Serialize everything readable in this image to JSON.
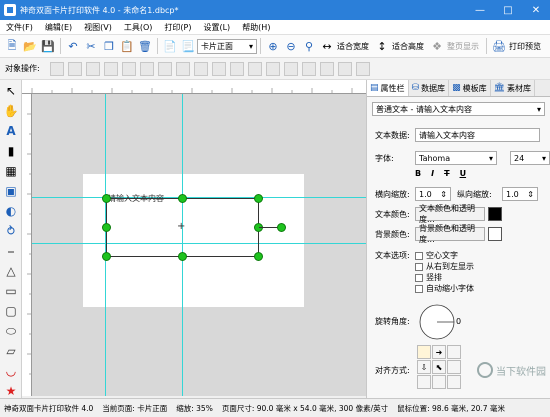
{
  "window": {
    "title": "神奇双面卡片打印软件 4.0 - 未命名1.dbcp*"
  },
  "menu": [
    "文件(F)",
    "编辑(E)",
    "视图(V)",
    "工具(O)",
    "打印(P)",
    "设置(L)",
    "帮助(H)"
  ],
  "toolbar": {
    "side_select": "卡片正面",
    "fit_width": "适合宽度",
    "fit_height": "适合高度",
    "full_display": "整页显示",
    "print_preview": "打印预览"
  },
  "toolbar2": {
    "label": "对象操作:"
  },
  "canvas": {
    "sample_text": "请输入文本内容"
  },
  "panel": {
    "tabs": [
      "属性栏",
      "数据库",
      "模板库",
      "素材库"
    ],
    "object_type": "普通文本 - 请输入文本内容",
    "text_data_label": "文本数据:",
    "text_data_value": "请输入文本内容",
    "font_label": "字体:",
    "font_value": "Tahoma",
    "font_size": "24",
    "bold": "B",
    "italic": "I",
    "strike": "T",
    "underline": "U",
    "hscale_label": "横向缩放:",
    "hscale_value": "1.0",
    "vscale_label": "纵向缩放:",
    "vscale_value": "1.0",
    "text_color_label": "文本颜色:",
    "text_color_btn": "文本颜色和透明度...",
    "text_color": "#000000",
    "bg_color_label": "背景颜色:",
    "bg_color_btn": "背景颜色和透明度...",
    "bg_color": "#ffffff",
    "text_options_label": "文本选项:",
    "options": [
      "空心文字",
      "从右到左显示",
      "竖排",
      "自动缩小字体"
    ],
    "rotation_label": "旋转角度:",
    "rotation_value": "0",
    "align_label": "对齐方式:"
  },
  "status": {
    "app": "神奇双面卡片打印软件 4.0",
    "page": "当前页面: 卡片正面",
    "zoom": "缩放: 35%",
    "size": "页面尺寸: 90.0 毫米 x 54.0 毫米, 300 像素/英寸",
    "mouse": "鼠标位置: 98.6 毫米, 20.7 毫米"
  },
  "watermark": "当下软件园"
}
